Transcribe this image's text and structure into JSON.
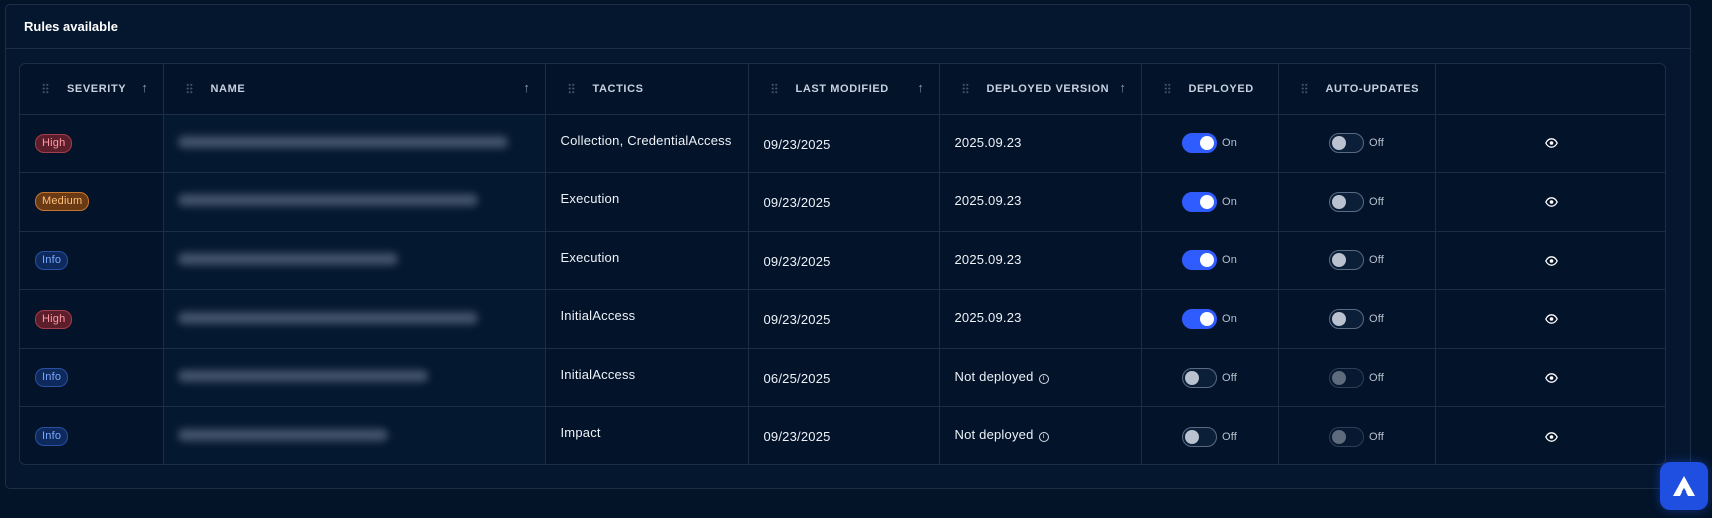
{
  "panel": {
    "title": "Rules available"
  },
  "table": {
    "columns": [
      {
        "key": "severity",
        "label": "SEVERITY"
      },
      {
        "key": "name",
        "label": "NAME"
      },
      {
        "key": "tactics",
        "label": "TACTICS"
      },
      {
        "key": "last_modified",
        "label": "LAST MODIFIED"
      },
      {
        "key": "deployed_version",
        "label": "DEPLOYED VERSION"
      },
      {
        "key": "deployed",
        "label": "DEPLOYED"
      },
      {
        "key": "auto_updates",
        "label": "AUTO-UPDATES"
      },
      {
        "key": "actions",
        "label": ""
      }
    ],
    "rows": [
      {
        "severity": "High",
        "severity_level": "high",
        "tactics": "Collection, CredentialAccess",
        "last_modified": "09/23/2025",
        "deployed_version": "2025.09.23",
        "deployed": true,
        "deployed_label": "On",
        "auto_updates": false,
        "auto_updates_label": "Off",
        "auto_updates_disabled": false
      },
      {
        "severity": "Medium",
        "severity_level": "medium",
        "tactics": "Execution",
        "last_modified": "09/23/2025",
        "deployed_version": "2025.09.23",
        "deployed": true,
        "deployed_label": "On",
        "auto_updates": false,
        "auto_updates_label": "Off",
        "auto_updates_disabled": false
      },
      {
        "severity": "Info",
        "severity_level": "info",
        "tactics": "Execution",
        "last_modified": "09/23/2025",
        "deployed_version": "2025.09.23",
        "deployed": true,
        "deployed_label": "On",
        "auto_updates": false,
        "auto_updates_label": "Off",
        "auto_updates_disabled": false
      },
      {
        "severity": "High",
        "severity_level": "high",
        "tactics": "InitialAccess",
        "last_modified": "09/23/2025",
        "deployed_version": "2025.09.23",
        "deployed": true,
        "deployed_label": "On",
        "auto_updates": false,
        "auto_updates_label": "Off",
        "auto_updates_disabled": false
      },
      {
        "severity": "Info",
        "severity_level": "info",
        "tactics": "InitialAccess",
        "last_modified": "06/25/2025",
        "deployed_version": "Not deployed",
        "deployed_version_info": true,
        "deployed": false,
        "deployed_label": "Off",
        "auto_updates": false,
        "auto_updates_label": "Off",
        "auto_updates_disabled": true
      },
      {
        "severity": "Info",
        "severity_level": "info",
        "tactics": "Impact",
        "last_modified": "09/23/2025",
        "deployed_version": "Not deployed",
        "deployed_version_info": true,
        "deployed": false,
        "deployed_label": "Off",
        "auto_updates": false,
        "auto_updates_label": "Off",
        "auto_updates_disabled": true
      }
    ]
  },
  "icons": {
    "sort": "arrow-up-icon",
    "drag": "drag-handle-icon",
    "view": "eye-icon",
    "info": "info-circle-icon",
    "logo": "brand-logo-icon"
  },
  "colors": {
    "accent": "#2f5cff",
    "high": "#ff9aa6",
    "medium": "#ffc078",
    "info": "#7aa7ff"
  }
}
